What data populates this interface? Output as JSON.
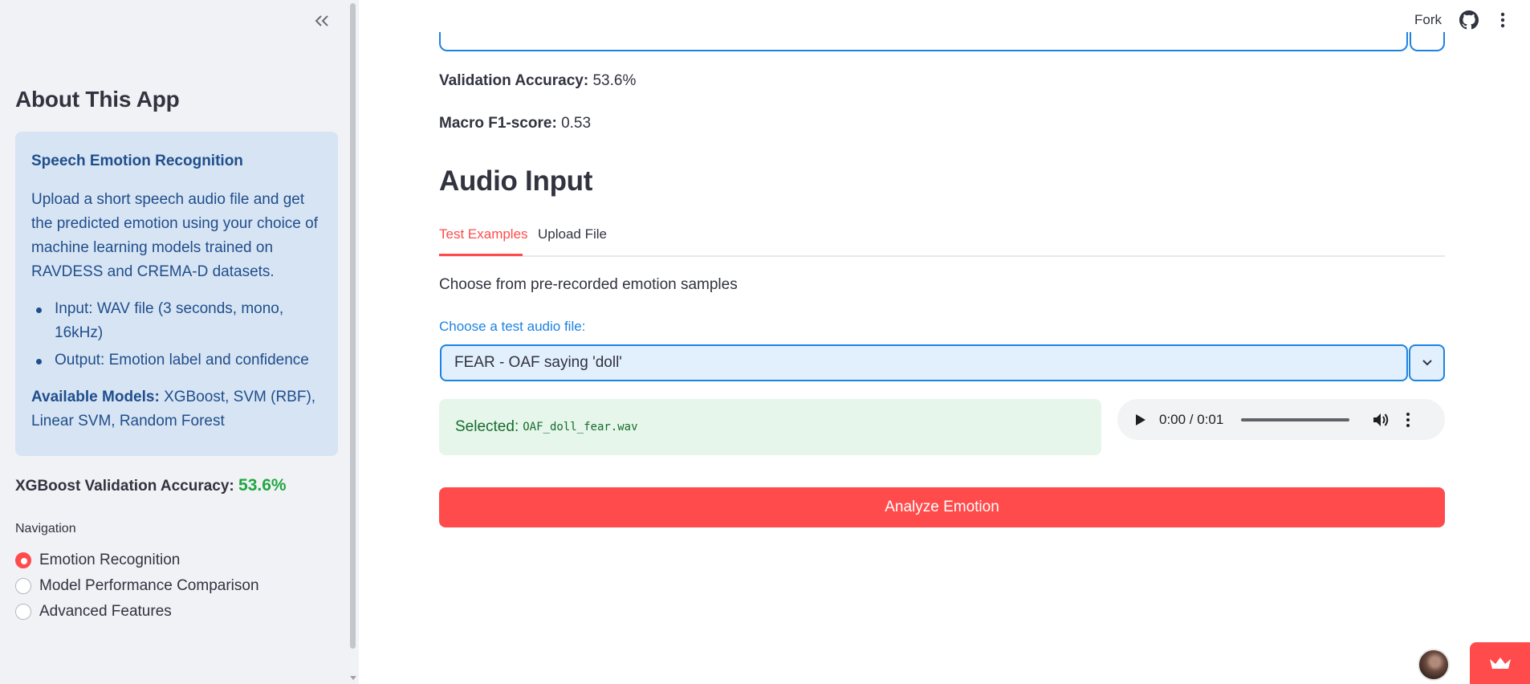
{
  "header": {
    "fork_label": "Fork"
  },
  "sidebar": {
    "title": "About This App",
    "info": {
      "heading": "Speech Emotion Recognition",
      "description": "Upload a short speech audio file and get the predicted emotion using your choice of machine learning models trained on RAVDESS and CREMA-D datasets.",
      "bullets": [
        "Input: WAV file (3 seconds, mono, 16kHz)",
        "Output: Emotion label and confidence"
      ],
      "models_label": "Available Models:",
      "models_value": "XGBoost, SVM (RBF), Linear SVM, Random Forest"
    },
    "accuracy_label": "XGBoost Validation Accuracy:",
    "accuracy_value": "53.6%",
    "nav_label": "Navigation",
    "nav_options": [
      {
        "label": "Emotion Recognition",
        "checked": true
      },
      {
        "label": "Model Performance Comparison",
        "checked": false
      },
      {
        "label": "Advanced Features",
        "checked": false
      }
    ]
  },
  "main": {
    "validation_accuracy_label": "Validation Accuracy:",
    "validation_accuracy_value": "53.6%",
    "macro_f1_label": "Macro F1-score:",
    "macro_f1_value": "0.53",
    "section_title": "Audio Input",
    "tabs": [
      {
        "label": "Test Examples",
        "active": true
      },
      {
        "label": "Upload File",
        "active": false
      }
    ],
    "help_text": "Choose from pre-recorded emotion samples",
    "select_label": "Choose a test audio file:",
    "select_value": "FEAR - OAF saying 'doll'",
    "selected_label": "Selected:",
    "selected_file": "OAF_doll_fear.wav",
    "audio": {
      "time": "0:00 / 0:01",
      "progress": 0
    },
    "analyze_button": "Analyze Emotion"
  },
  "colors": {
    "primary": "#ff4b4b",
    "info_bg": "#d7e4f3",
    "info_text": "#1f4e8c",
    "success_bg": "#e6f6ea",
    "success_text": "#176c2e",
    "accent_blue": "#1c83e1",
    "accuracy_green": "#21a641"
  }
}
